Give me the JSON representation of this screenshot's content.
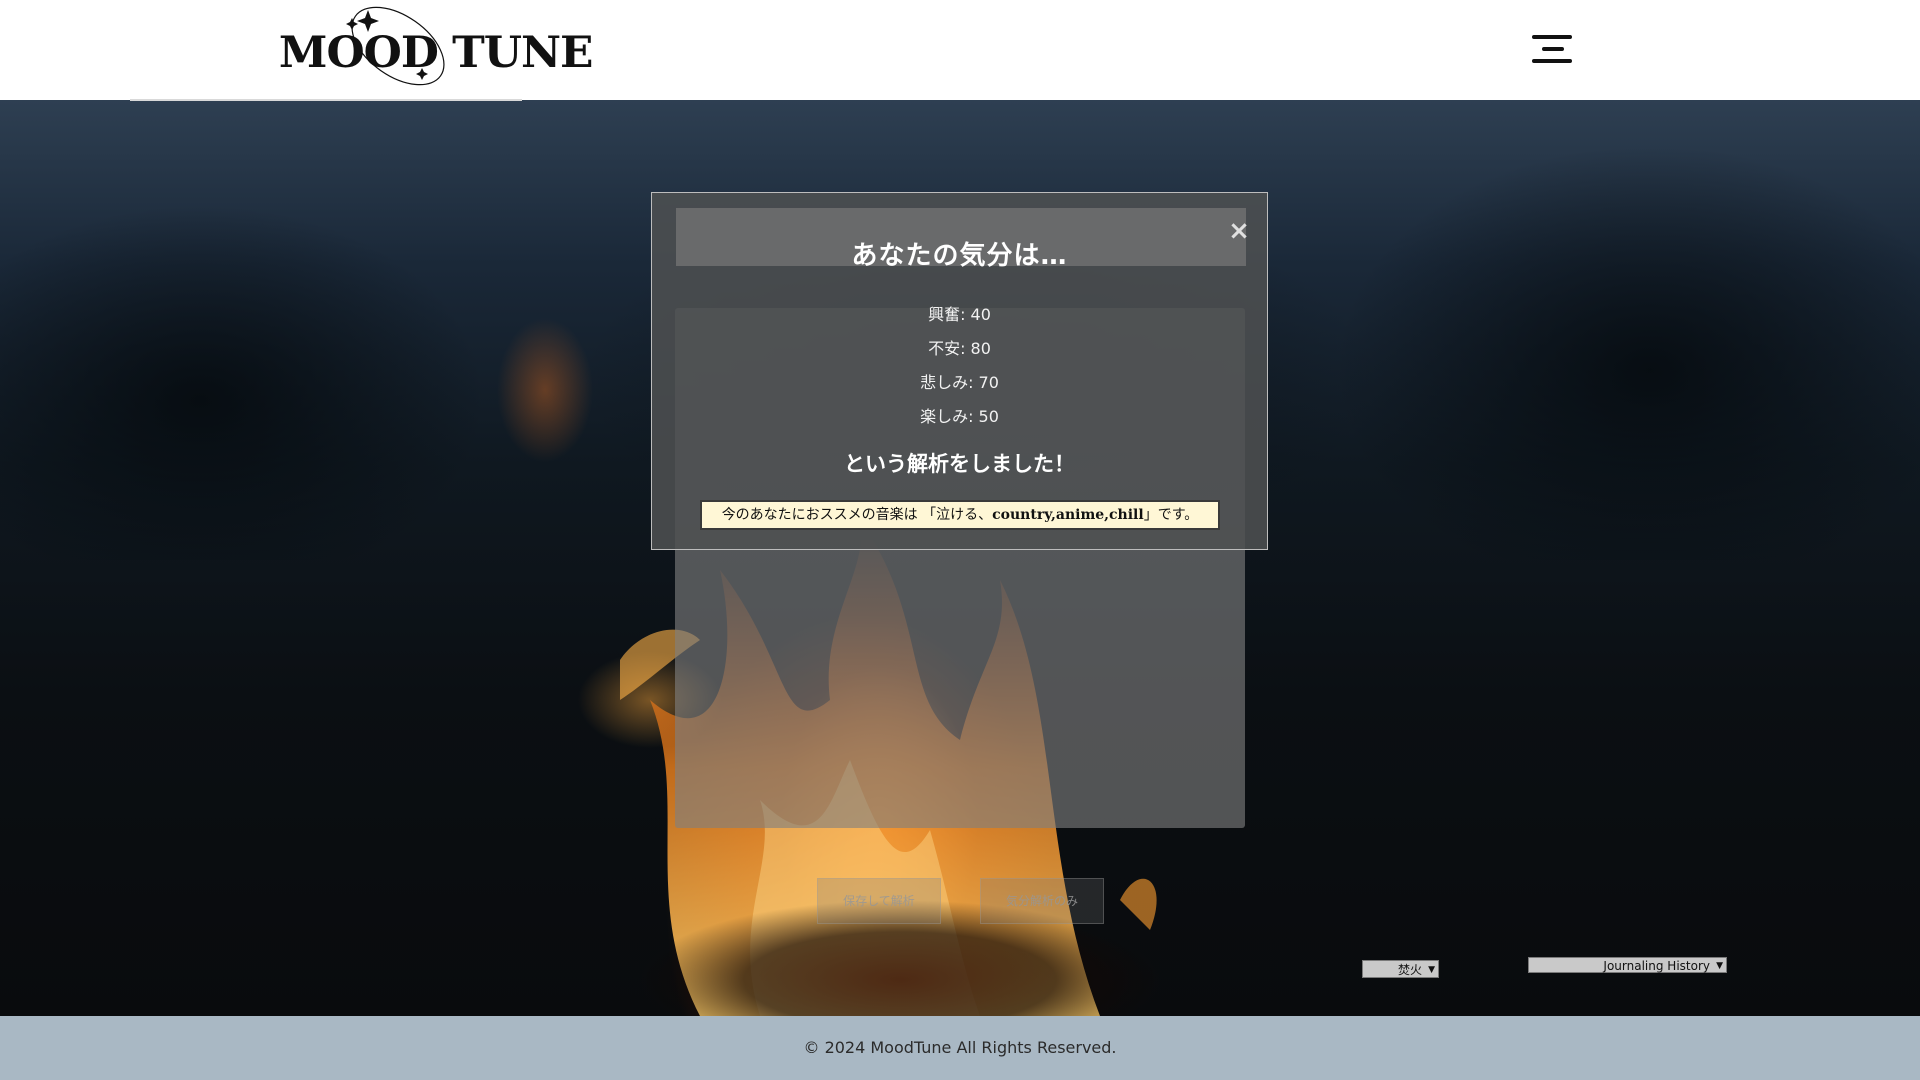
{
  "header": {
    "logo_text": "MOOD TUNE",
    "menu_icon": "hamburger-menu-icon"
  },
  "modal": {
    "title": "あなたの気分は…",
    "close_label": "×",
    "scores": [
      {
        "label": "興奮: 40"
      },
      {
        "label": "不安: 80"
      },
      {
        "label": "悲しみ: 70"
      },
      {
        "label": "楽しみ: 50"
      }
    ],
    "result_message": "という解析をしました！",
    "recommend_prefix": "今のあなたにおススメの音楽は 「泣ける、",
    "recommend_genres": "country,anime,chill",
    "recommend_suffix": "」です。"
  },
  "actions": {
    "save_analyze_label": "保存して解析",
    "analyze_only_label": "気分解析のみ"
  },
  "controls": {
    "background_select_value": "焚火",
    "history_select_value": "Journaling History"
  },
  "footer": {
    "copyright": "© 2024 MoodTune All Rights Reserved."
  },
  "colors": {
    "header_bg": "#ffffff",
    "footer_bg": "#a9b8c4",
    "recommend_bg": "#fff7d6"
  }
}
